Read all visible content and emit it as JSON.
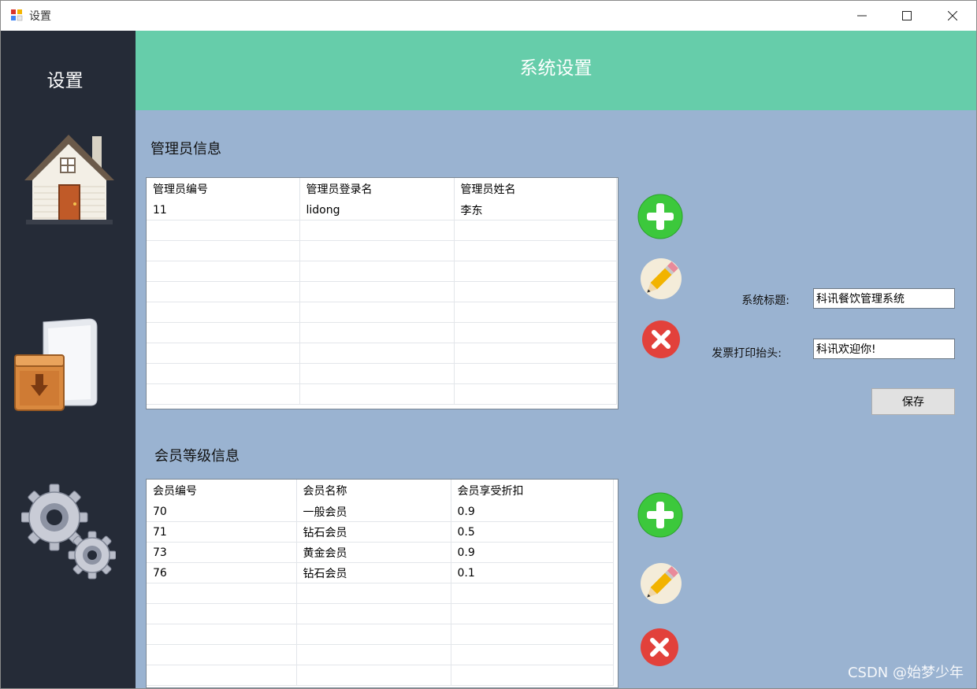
{
  "window": {
    "title": "设置",
    "minimize_glyph": "—",
    "maximize_glyph": "☐",
    "close_glyph": "✕"
  },
  "sidebar": {
    "title": "设置",
    "items": [
      {
        "icon": "house-icon"
      },
      {
        "icon": "archive-box-icon"
      },
      {
        "icon": "gears-icon"
      }
    ]
  },
  "header": {
    "title": "系统设置"
  },
  "admin": {
    "label": "管理员信息",
    "columns": [
      "管理员编号",
      "管理员登录名",
      "管理员姓名"
    ],
    "rows": [
      [
        "11",
        "lidong",
        "李东"
      ]
    ]
  },
  "member": {
    "label": "会员等级信息",
    "columns": [
      "会员编号",
      "会员名称",
      "会员享受折扣"
    ],
    "rows": [
      [
        "70",
        "一般会员",
        "0.9"
      ],
      [
        "71",
        "钻石会员",
        "0.5"
      ],
      [
        "73",
        "黄金会员",
        "0.9"
      ],
      [
        "76",
        "钻石会员",
        "0.1"
      ]
    ]
  },
  "settings": {
    "system_title_label": "系统标题:",
    "system_title_value": "科讯餐饮管理系统",
    "invoice_header_label": "发票打印抬头:",
    "invoice_header_value": "科讯欢迎你!",
    "save_label": "保存"
  },
  "watermark": "CSDN @始梦少年",
  "colors": {
    "sidebar": "#252b37",
    "header": "#66cdaa",
    "content": "#9ab3d1",
    "add": "#3cc83c",
    "delete": "#e2413b"
  }
}
